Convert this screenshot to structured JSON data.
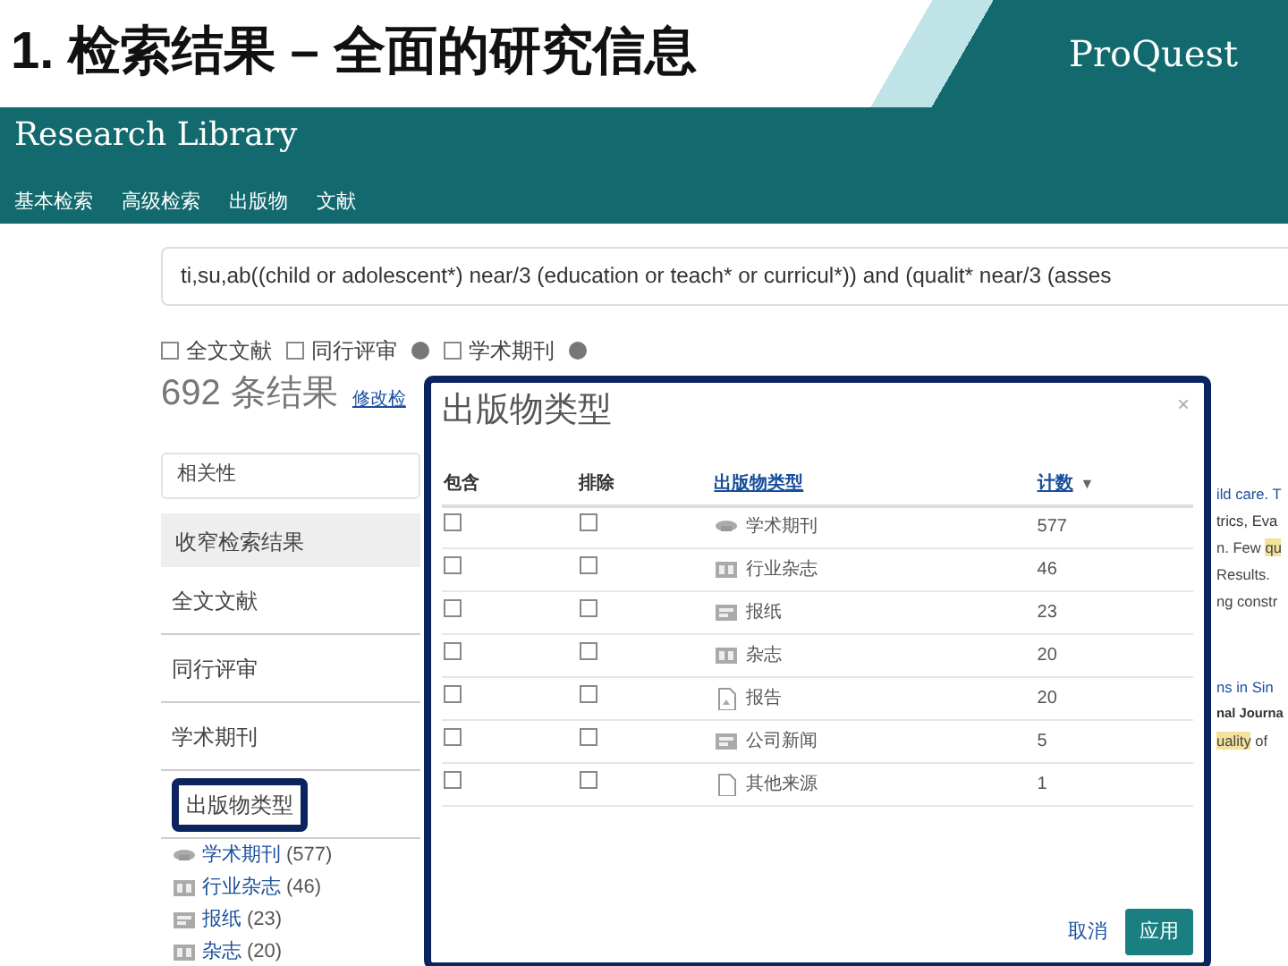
{
  "slide": {
    "title": "1. 检索结果 – 全面的研究信息",
    "logo": "ProQuest"
  },
  "header": {
    "title": "Research Library",
    "nav": [
      {
        "label": "基本检索"
      },
      {
        "label": "高级检索"
      },
      {
        "label": "出版物"
      },
      {
        "label": "文献"
      }
    ]
  },
  "search": {
    "value": "ti,su,ab((child or adolescent*) near/3 (education or teach* or curricul*)) and (qualit* near/3 (asses"
  },
  "filters": [
    {
      "label": "全文文献",
      "checked": false,
      "info": false
    },
    {
      "label": "同行评审",
      "checked": false,
      "info": true
    },
    {
      "label": "学术期刊",
      "checked": false,
      "info": true
    }
  ],
  "results": {
    "count": "692 条结果",
    "modify_link": "修改检"
  },
  "sort": {
    "value": "相关性"
  },
  "narrow": {
    "title": "收窄检索结果",
    "facets": [
      {
        "label": "全文文献",
        "highlighted": false
      },
      {
        "label": "同行评审",
        "highlighted": false
      },
      {
        "label": "学术期刊",
        "highlighted": false
      },
      {
        "label": "出版物类型",
        "highlighted": true
      }
    ],
    "pub_types": [
      {
        "kind": "journal",
        "label": "学术期刊",
        "count": "(577)"
      },
      {
        "kind": "trade",
        "label": "行业杂志",
        "count": "(46)"
      },
      {
        "kind": "newspaper",
        "label": "报纸",
        "count": "(23)"
      },
      {
        "kind": "magazine",
        "label": "杂志",
        "count": "(20)"
      }
    ]
  },
  "snippets": [
    {
      "kind": "title",
      "segments": [
        {
          "text": "ild care. T",
          "highlight": false
        }
      ]
    },
    {
      "kind": "meta",
      "segments": [
        {
          "text": "trics, Eva",
          "highlight": false
        }
      ]
    },
    {
      "kind": "text",
      "segments": [
        {
          "text": "n. Few ",
          "highlight": false
        },
        {
          "text": "qu",
          "highlight": true
        }
      ]
    },
    {
      "kind": "text",
      "segments": [
        {
          "text": "Results.",
          "highlight": false
        }
      ]
    },
    {
      "kind": "text",
      "segments": [
        {
          "text": "ng constr",
          "highlight": false
        }
      ]
    },
    {
      "kind": "title",
      "segments": [
        {
          "text": "ns in Sin",
          "highlight": false
        }
      ]
    },
    {
      "kind": "source",
      "segments": [
        {
          "text": "nal Journa",
          "highlight": false
        }
      ]
    },
    {
      "kind": "text",
      "segments": [
        {
          "text": "uality",
          "highlight": true
        },
        {
          "text": " of",
          "highlight": false
        }
      ]
    }
  ],
  "modal": {
    "title": "出版物类型",
    "close": "×",
    "columns": [
      "包含",
      "排除",
      "出版物类型",
      "计数"
    ],
    "sort_arrow": "▼",
    "rows": [
      {
        "kind": "journal",
        "label": "学术期刊",
        "count": "577",
        "include": false,
        "exclude": false
      },
      {
        "kind": "trade",
        "label": "行业杂志",
        "count": "46",
        "include": false,
        "exclude": false
      },
      {
        "kind": "newspaper",
        "label": "报纸",
        "count": "23",
        "include": false,
        "exclude": false
      },
      {
        "kind": "magazine",
        "label": "杂志",
        "count": "20",
        "include": false,
        "exclude": false
      },
      {
        "kind": "report",
        "label": "报告",
        "count": "20",
        "include": false,
        "exclude": false
      },
      {
        "kind": "wire",
        "label": "公司新闻",
        "count": "5",
        "include": false,
        "exclude": false
      },
      {
        "kind": "other",
        "label": "其他来源",
        "count": "1",
        "include": false,
        "exclude": false
      }
    ],
    "cancel": "取消",
    "apply": "应用"
  }
}
